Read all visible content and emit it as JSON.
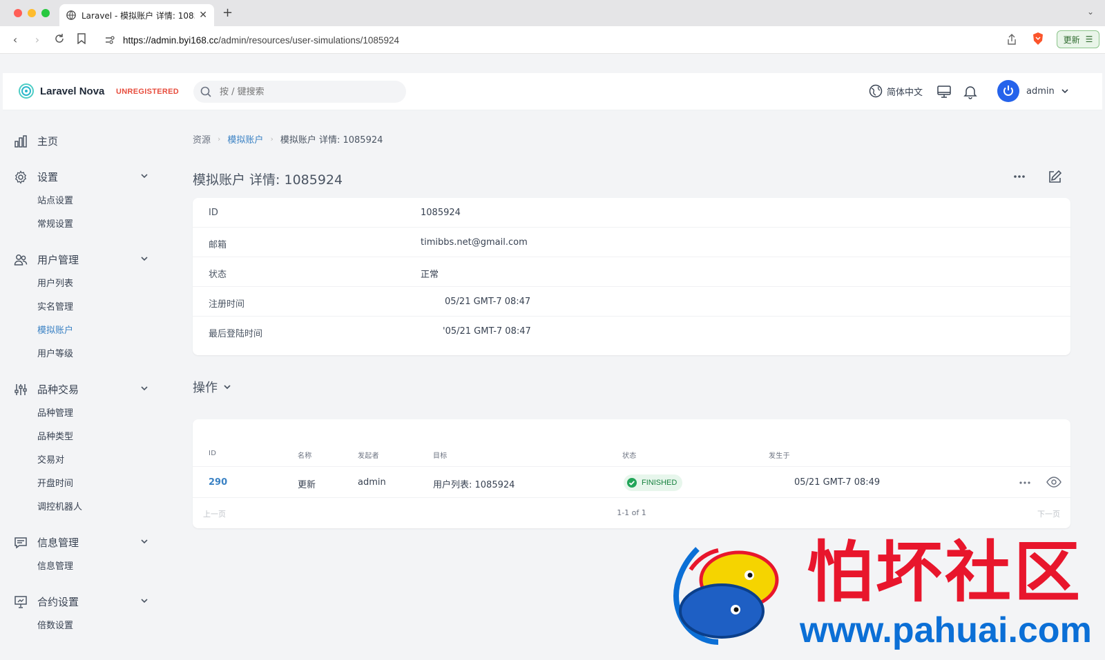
{
  "browser": {
    "tab_title": "Laravel - 模拟账户 详情: 1085924",
    "url_host": "https://admin.byi168.cc",
    "url_path": "/admin/resources/user-simulations/1085924",
    "update_label": "更新"
  },
  "header": {
    "brand": "Laravel Nova",
    "badge": "UNREGISTERED",
    "search_placeholder": "按 / 键搜索",
    "language": "简体中文",
    "user": "admin"
  },
  "sidebar": {
    "home": "主页",
    "groups": [
      {
        "label": "设置",
        "items": [
          "站点设置",
          "常规设置"
        ]
      },
      {
        "label": "用户管理",
        "items": [
          "用户列表",
          "实名管理",
          "模拟账户",
          "用户等级"
        ]
      },
      {
        "label": "品种交易",
        "items": [
          "品种管理",
          "品种类型",
          "交易对",
          "开盘时间",
          "调控机器人"
        ]
      },
      {
        "label": "信息管理",
        "items": [
          "信息管理"
        ]
      },
      {
        "label": "合约设置",
        "items": [
          "倍数设置"
        ]
      }
    ],
    "active_item": "模拟账户"
  },
  "breadcrumb": {
    "root": "资源",
    "parent": "模拟账户",
    "current": "模拟账户 详情: 1085924"
  },
  "page": {
    "title": "模拟账户 详情: 1085924"
  },
  "details": [
    {
      "label": "ID",
      "value": "1085924"
    },
    {
      "label": "邮箱",
      "value": "timibbs.net@gmail.com"
    },
    {
      "label": "状态",
      "value": "正常"
    },
    {
      "label": "注册时间",
      "value": "05/21 GMT-7 08:47"
    },
    {
      "label": "最后登陆时间",
      "value": "'05/21 GMT-7 08:47"
    }
  ],
  "actions": {
    "section_title": "操作",
    "columns": [
      "ID",
      "名称",
      "发起者",
      "目标",
      "状态",
      "发生于"
    ],
    "rows": [
      {
        "id": "290",
        "name": "更新",
        "initiator": "admin",
        "target": "用户列表: 1085924",
        "status": "FINISHED",
        "occurred_at": "05/21 GMT-7 08:49"
      }
    ],
    "pager": {
      "prev": "上一页",
      "count": "1-1 of 1",
      "next": "下一页"
    }
  },
  "watermark": {
    "cn": "怕坏社区",
    "url": "www.pahuai.com"
  },
  "colors": {
    "accent": "#3b82c4",
    "badge": "#e74c3c",
    "status_ok": "#15803d",
    "avatar": "#2563eb"
  }
}
